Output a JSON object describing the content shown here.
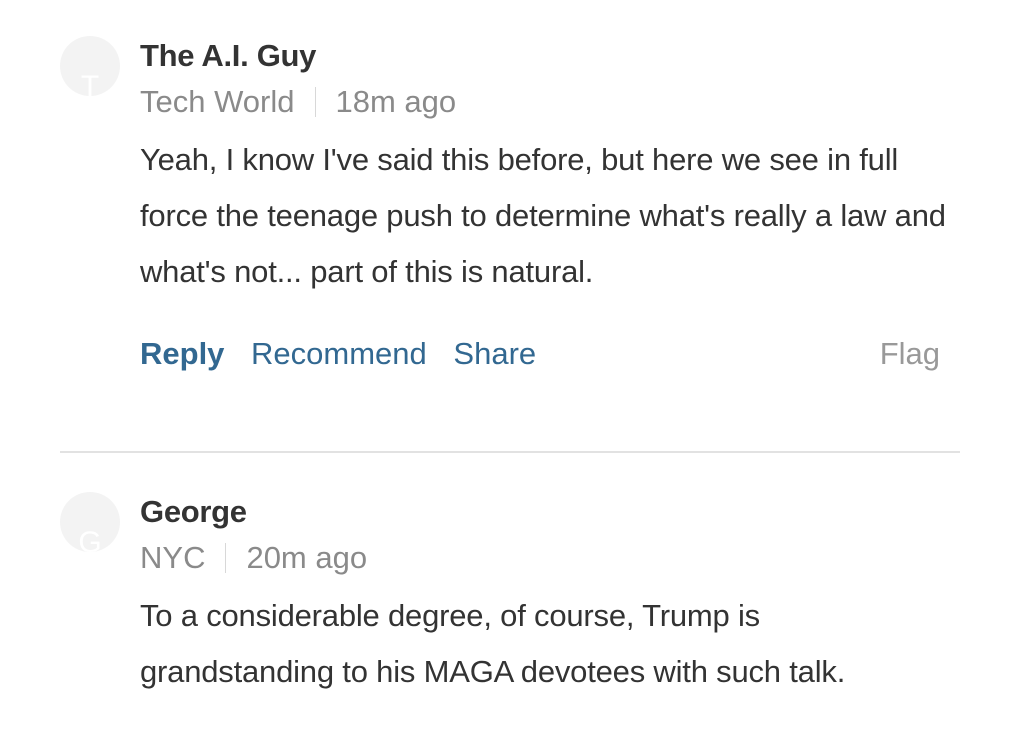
{
  "comments": [
    {
      "avatar_letter": "T",
      "author": "The A.I. Guy",
      "location": "Tech World",
      "time": "18m ago",
      "body": "Yeah, I know I've said this before, but here we see in full force the teenage push to determine what's really a law and what's not... part of this is natural.",
      "actions": {
        "reply": "Reply",
        "recommend": "Recommend",
        "share": "Share",
        "flag": "Flag"
      }
    },
    {
      "avatar_letter": "G",
      "author": "George",
      "location": "NYC",
      "time": "20m ago",
      "body": "To a considerable degree, of course, Trump is grandstanding to his MAGA devotees with such talk."
    }
  ],
  "colors": {
    "action_link": "#326891",
    "meta_text": "#8a8a8a",
    "body_text": "#333333",
    "flag_text": "#999999"
  }
}
